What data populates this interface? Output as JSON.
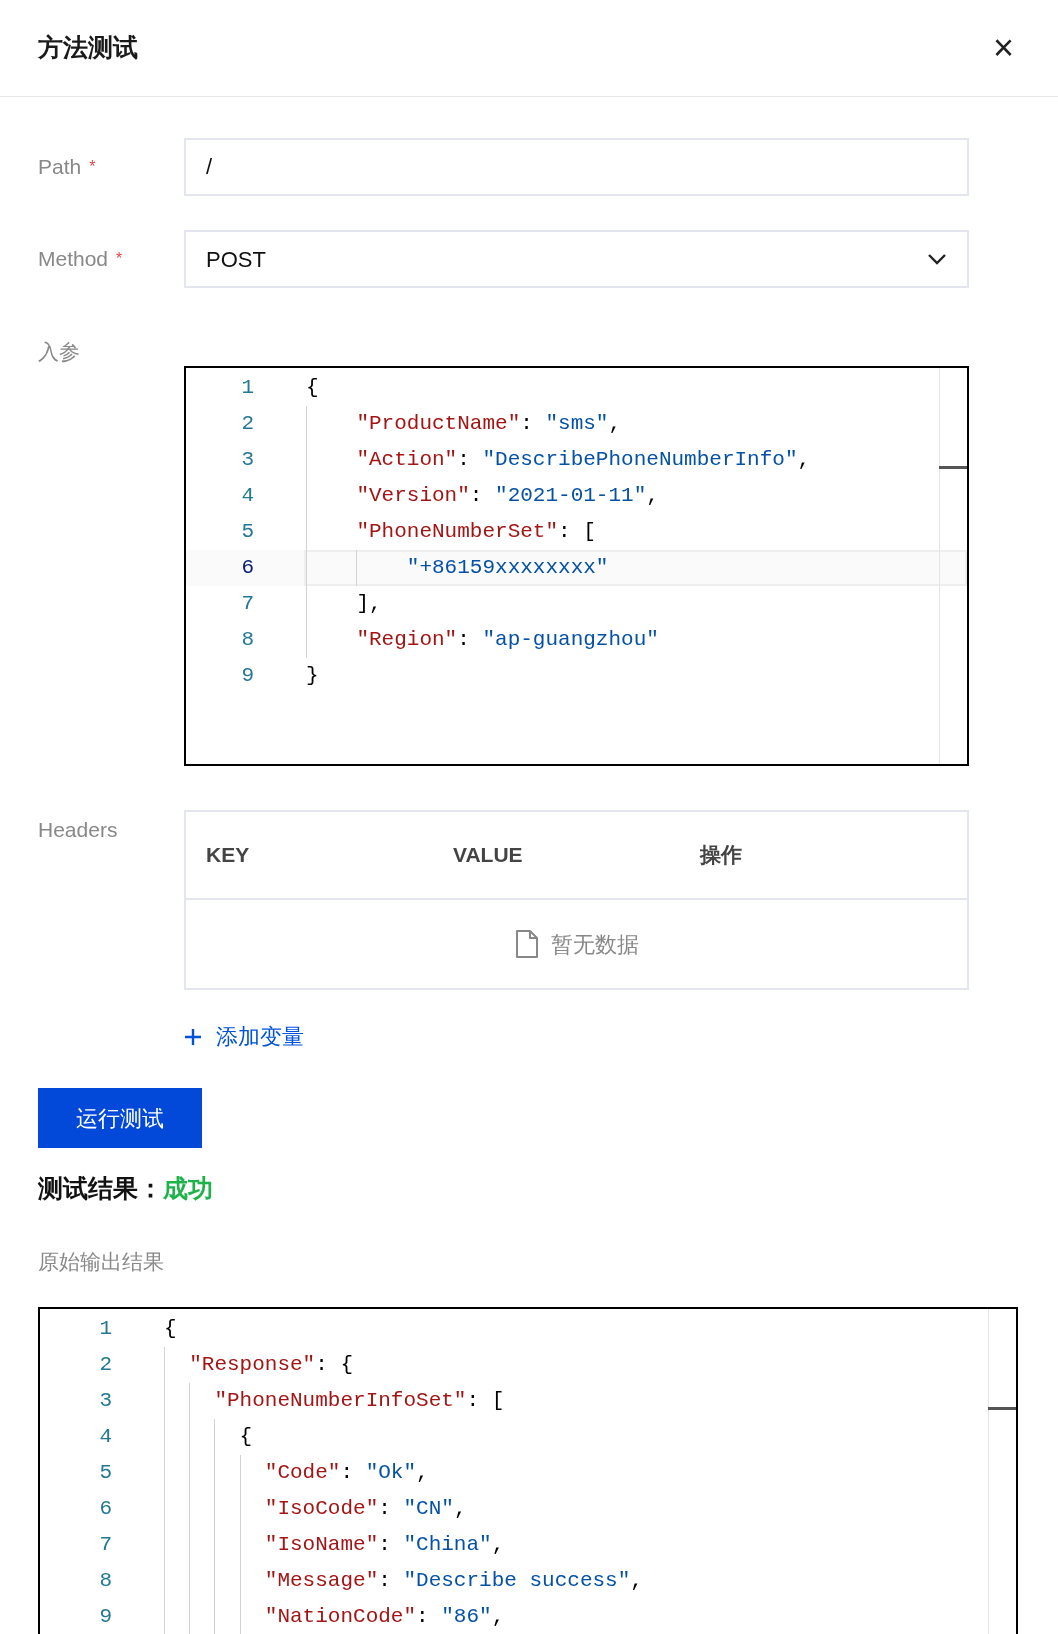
{
  "dialog": {
    "title": "方法测试",
    "close": "×"
  },
  "form": [
    {
      "kind": "text",
      "label": "Path",
      "required_mark": "*",
      "value": "/"
    },
    {
      "kind": "select",
      "label": "Method",
      "required_mark": "*",
      "value": "POST"
    }
  ],
  "params": {
    "label": "入参",
    "lines": [
      {
        "number": "1",
        "active": false,
        "tokens": [
          {
            "kind": "punct",
            "text": "{"
          }
        ]
      },
      {
        "number": "2",
        "active": false,
        "tokens": [
          {
            "kind": "key",
            "text": "    \"ProductName\""
          },
          {
            "kind": "punct",
            "text": ": "
          },
          {
            "kind": "string",
            "text": "\"sms\""
          },
          {
            "kind": "punct",
            "text": ","
          }
        ]
      },
      {
        "number": "3",
        "active": false,
        "tokens": [
          {
            "kind": "key",
            "text": "    \"Action\""
          },
          {
            "kind": "punct",
            "text": ": "
          },
          {
            "kind": "string",
            "text": "\"DescribePhoneNumberInfo\""
          },
          {
            "kind": "punct",
            "text": ","
          }
        ]
      },
      {
        "number": "4",
        "active": false,
        "tokens": [
          {
            "kind": "key",
            "text": "    \"Version\""
          },
          {
            "kind": "punct",
            "text": ": "
          },
          {
            "kind": "string",
            "text": "\"2021-01-11\""
          },
          {
            "kind": "punct",
            "text": ","
          }
        ]
      },
      {
        "number": "5",
        "active": false,
        "tokens": [
          {
            "kind": "key",
            "text": "    \"PhoneNumberSet\""
          },
          {
            "kind": "punct",
            "text": ": ["
          }
        ]
      },
      {
        "number": "6",
        "active": true,
        "tokens": [
          {
            "kind": "string",
            "text": "        \"+86159xxxxxxxx\""
          }
        ]
      },
      {
        "number": "7",
        "active": false,
        "tokens": [
          {
            "kind": "punct",
            "text": "    ],"
          }
        ]
      },
      {
        "number": "8",
        "active": false,
        "tokens": [
          {
            "kind": "key",
            "text": "    \"Region\""
          },
          {
            "kind": "punct",
            "text": ": "
          },
          {
            "kind": "string",
            "text": "\"ap-guangzhou\""
          }
        ]
      },
      {
        "number": "9",
        "active": false,
        "tokens": [
          {
            "kind": "punct",
            "text": "}"
          }
        ]
      }
    ]
  },
  "headers": {
    "label": "Headers",
    "columns": [
      "KEY",
      "VALUE",
      "操作"
    ],
    "empty": "暂无数据",
    "add": "添加变量"
  },
  "run_button": "运行测试",
  "result": {
    "label": "测试结果：",
    "status": "成功"
  },
  "output": {
    "label": "原始输出结果",
    "lines": [
      {
        "number": "1",
        "active": false,
        "tokens": [
          {
            "kind": "punct",
            "text": "{"
          }
        ]
      },
      {
        "number": "2",
        "active": false,
        "tokens": [
          {
            "kind": "key",
            "text": "  \"Response\""
          },
          {
            "kind": "punct",
            "text": ": {"
          }
        ]
      },
      {
        "number": "3",
        "active": false,
        "tokens": [
          {
            "kind": "key",
            "text": "    \"PhoneNumberInfoSet\""
          },
          {
            "kind": "punct",
            "text": ": ["
          }
        ]
      },
      {
        "number": "4",
        "active": false,
        "tokens": [
          {
            "kind": "punct",
            "text": "      {"
          }
        ]
      },
      {
        "number": "5",
        "active": false,
        "tokens": [
          {
            "kind": "key",
            "text": "        \"Code\""
          },
          {
            "kind": "punct",
            "text": ": "
          },
          {
            "kind": "string",
            "text": "\"Ok\""
          },
          {
            "kind": "punct",
            "text": ","
          }
        ]
      },
      {
        "number": "6",
        "active": false,
        "tokens": [
          {
            "kind": "key",
            "text": "        \"IsoCode\""
          },
          {
            "kind": "punct",
            "text": ": "
          },
          {
            "kind": "string",
            "text": "\"CN\""
          },
          {
            "kind": "punct",
            "text": ","
          }
        ]
      },
      {
        "number": "7",
        "active": false,
        "tokens": [
          {
            "kind": "key",
            "text": "        \"IsoName\""
          },
          {
            "kind": "punct",
            "text": ": "
          },
          {
            "kind": "string",
            "text": "\"China\""
          },
          {
            "kind": "punct",
            "text": ","
          }
        ]
      },
      {
        "number": "8",
        "active": false,
        "tokens": [
          {
            "kind": "key",
            "text": "        \"Message\""
          },
          {
            "kind": "punct",
            "text": ": "
          },
          {
            "kind": "string",
            "text": "\"Describe success\""
          },
          {
            "kind": "punct",
            "text": ","
          }
        ]
      },
      {
        "number": "9",
        "active": false,
        "tokens": [
          {
            "kind": "key",
            "text": "        \"NationCode\""
          },
          {
            "kind": "punct",
            "text": ": "
          },
          {
            "kind": "string",
            "text": "\"86\""
          },
          {
            "kind": "punct",
            "text": ","
          }
        ]
      }
    ]
  }
}
